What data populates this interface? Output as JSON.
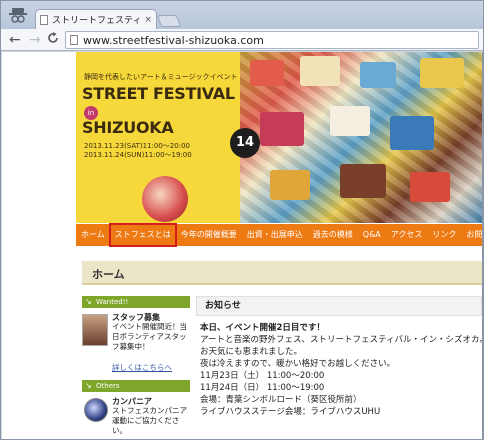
{
  "browser": {
    "tab_title": "ストリートフェスティバル",
    "tab_close": "×",
    "back": "←",
    "forward": "→",
    "reload": "C",
    "url": "www.streetfestival-shizuoka.com"
  },
  "hero": {
    "subtitle": "静岡を代表したいアート＆ミュージックイベント",
    "title_line1": "STREET FESTIVAL",
    "in_badge": "in",
    "title_line2": "SHIZUOKA",
    "date1": "2013.11.23(SAT)11:00〜20:00",
    "date2": "2013.11.24(SUN)11:00〜19:00",
    "edition": "14",
    "colors": {
      "yellow": "#f6d83a",
      "nav_orange": "#ee7a14"
    }
  },
  "nav": {
    "items": [
      "ホーム",
      "ストフェスとは",
      "今年の開催概要",
      "出資・出展申込",
      "過去の模様",
      "Q&A",
      "アクセス",
      "リンク",
      "お問い"
    ],
    "highlight_color": "#d41d1d"
  },
  "home_heading": "ホーム",
  "sidebar": {
    "wanted_label": "Wanted!!",
    "staff": {
      "title": "スタッフ募集",
      "text": "イベント開催間近！当日ボランティアスタッフ募集中！",
      "link": "詳しくはこちらへ"
    },
    "others_label": "Others",
    "campaign": {
      "title": "カンパニア",
      "text": "ストフェスカンパニア運動にご協力ください。"
    }
  },
  "news": {
    "heading": "お知らせ",
    "lines": [
      "本日、イベント開催2日目です！",
      "アートと音楽の野外フェス、ストリートフェスティバル・イン・シズオカ。",
      "お天気にも恵まれました。",
      "夜は冷えますので、暖かい格好でお越しください。",
      "11月23日（土） 11:00〜20:00",
      "11月24日（日） 11:00〜19:00",
      "会場：青葉シンボルロード（葵区役所前）",
      "ライブハウスステージ会場：ライブハウスUHU"
    ]
  }
}
